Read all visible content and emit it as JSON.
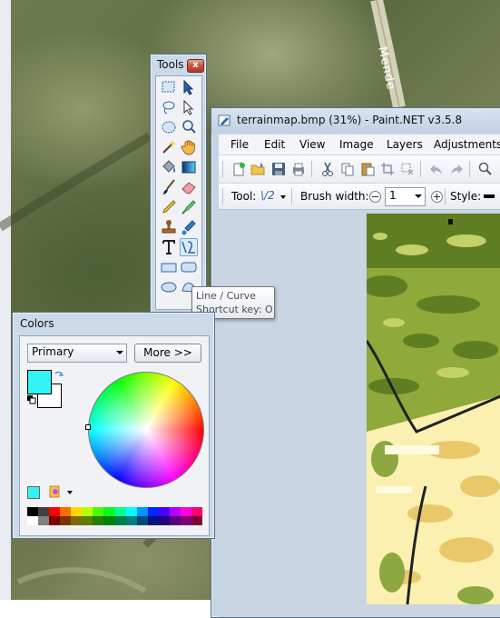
{
  "background": {
    "road_label": "Mende"
  },
  "paintnet": {
    "title": "terrainmap.bmp (31%) - Paint.NET v3.5.8",
    "menu": [
      "File",
      "Edit",
      "View",
      "Image",
      "Layers",
      "Adjustments"
    ],
    "toolbar": {
      "tool_label": "Tool:",
      "tool_value": "\\/2",
      "brush_width_label": "Brush width:",
      "brush_width_value": "1",
      "style_label": "Style:"
    },
    "toolbar_icons": [
      "new-icon",
      "open-icon",
      "save-icon",
      "print-icon",
      "cut-icon",
      "copy-icon",
      "paste-icon",
      "crop-icon",
      "deselect-icon",
      "undo-icon",
      "redo-icon",
      "zoom-icon"
    ]
  },
  "tools_window": {
    "title": "Tools",
    "close": "x",
    "tools": [
      "rectangle-select",
      "move-selection",
      "lasso-select",
      "move-selection-outline",
      "ellipse-select",
      "zoom",
      "magic-wand",
      "pan",
      "paint-bucket",
      "gradient",
      "paintbrush",
      "eraser",
      "pencil",
      "color-picker",
      "clone-stamp",
      "recolor",
      "text",
      "line-curve",
      "rectangle",
      "rounded-rectangle",
      "ellipse",
      "freeform-shape"
    ],
    "selected_tool": "line-curve",
    "tooltip": {
      "line1": "Line / Curve",
      "line2": "Shortcut key: O"
    }
  },
  "colors_window": {
    "title": "Colors",
    "close": "x",
    "mode_select": "Primary",
    "more_button": "More >>",
    "primary_color": "#33f3f5",
    "secondary_color": "#ffffff",
    "palette_top": [
      "#000000",
      "#404040",
      "#ff0000",
      "#ff6a00",
      "#ffd800",
      "#b6ff00",
      "#4cff00",
      "#00ff21",
      "#00ff90",
      "#00ffff",
      "#0094ff",
      "#0026ff",
      "#4800ff",
      "#b200ff",
      "#ff00dc",
      "#ff006e"
    ],
    "palette_bottom": [
      "#ffffff",
      "#808080",
      "#7f0000",
      "#7f3300",
      "#7f6a00",
      "#5b7f00",
      "#267f00",
      "#007f0e",
      "#007f46",
      "#007f7f",
      "#004a7f",
      "#00137f",
      "#21007f",
      "#57007f",
      "#7f006e",
      "#7f0037"
    ]
  }
}
